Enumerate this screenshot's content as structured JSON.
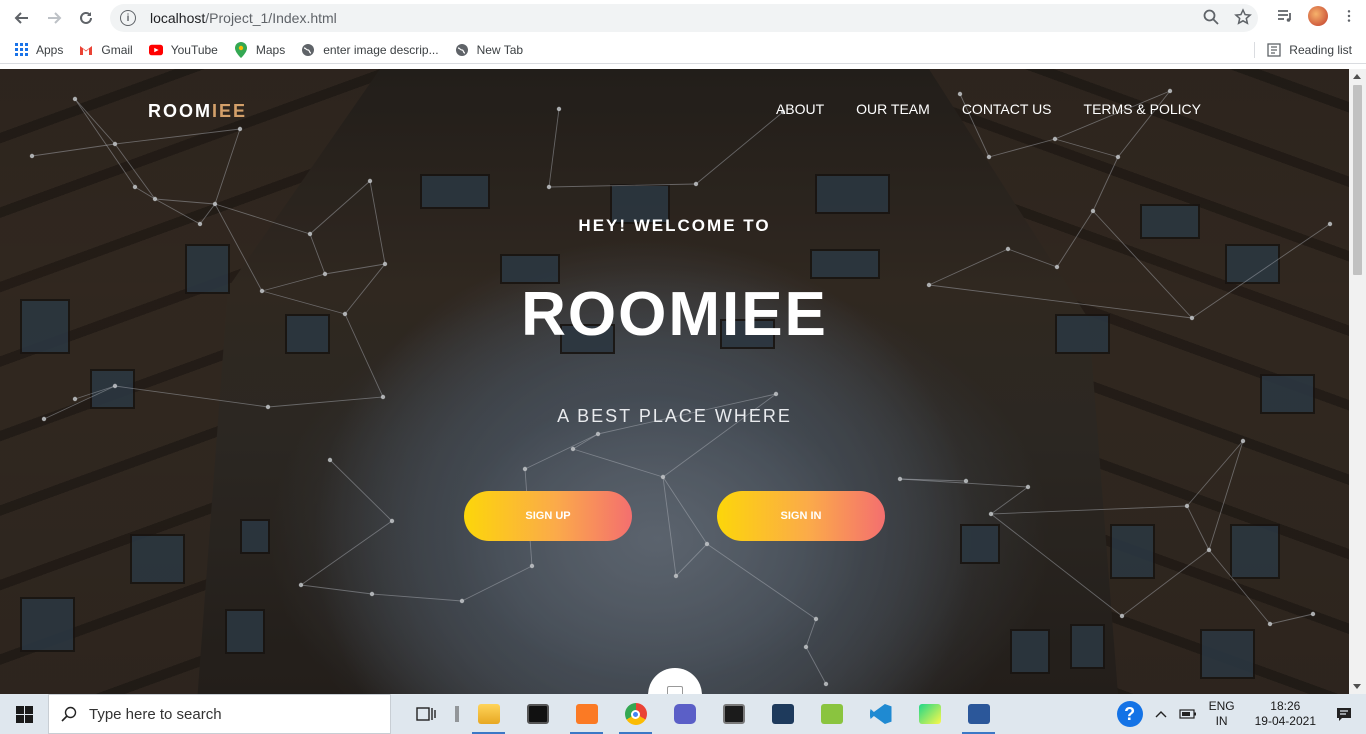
{
  "browser": {
    "url_host": "localhost",
    "url_path": "/Project_1/Index.html",
    "bookmarks": [
      {
        "label": "Apps",
        "icon": "apps-grid-icon"
      },
      {
        "label": "Gmail",
        "icon": "gmail-icon"
      },
      {
        "label": "YouTube",
        "icon": "youtube-icon"
      },
      {
        "label": "Maps",
        "icon": "maps-icon"
      },
      {
        "label": "enter image descrip...",
        "icon": "globe-icon"
      },
      {
        "label": "New Tab",
        "icon": "globe-icon"
      }
    ],
    "reading_list": "Reading list"
  },
  "site": {
    "brand_primary": "ROOM",
    "brand_accent": "IEE",
    "nav": [
      "ABOUT",
      "OUR TEAM",
      "CONTACT US",
      "TERMS & POLICY"
    ],
    "welcome": "HEY! WELCOME TO",
    "title": "ROOMIEE",
    "tagline": "A BEST PLACE WHERE",
    "signup_label": "SIGN UP",
    "signin_label": "SIGN IN",
    "button_gradient": [
      "#fcd60a",
      "#f46f6f"
    ]
  },
  "taskbar": {
    "search_placeholder": "Type here to search",
    "apps": [
      "task-view-icon",
      "file-explorer-icon",
      "terminal-icon",
      "xampp-icon",
      "chrome-icon",
      "teams-icon",
      "cmd-icon",
      "mysql-icon",
      "notepadpp-icon",
      "vscode-icon",
      "pycharm-icon",
      "word-icon"
    ],
    "lang_top": "ENG",
    "lang_bottom": "IN",
    "time": "18:26",
    "date": "19-04-2021"
  }
}
